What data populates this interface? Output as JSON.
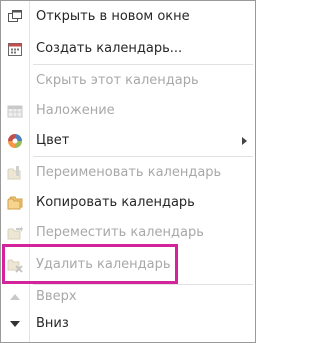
{
  "menu": {
    "items": [
      {
        "id": "open-new-window",
        "label": "Открыть в новом окне",
        "disabled": false
      },
      {
        "id": "create-calendar",
        "label": "Создать календарь...",
        "disabled": false
      },
      {
        "id": "hide-calendar",
        "label": "Скрыть этот календарь",
        "disabled": true
      },
      {
        "id": "overlay",
        "label": "Наложение",
        "disabled": true
      },
      {
        "id": "color",
        "label": "Цвет",
        "disabled": false,
        "submenu": true
      },
      {
        "id": "rename-calendar",
        "label": "Переименовать календарь",
        "disabled": true
      },
      {
        "id": "copy-calendar",
        "label": "Копировать календарь",
        "disabled": false
      },
      {
        "id": "move-calendar",
        "label": "Переместить календарь",
        "disabled": true
      },
      {
        "id": "delete-calendar",
        "label": "Удалить календарь",
        "disabled": true
      },
      {
        "id": "move-up",
        "label": "Вверх",
        "disabled": true
      },
      {
        "id": "move-down",
        "label": "Вниз",
        "disabled": false
      }
    ]
  },
  "colors": {
    "highlight": "#d4249b",
    "disabled_text": "#a8a8a8",
    "text": "#262626"
  }
}
